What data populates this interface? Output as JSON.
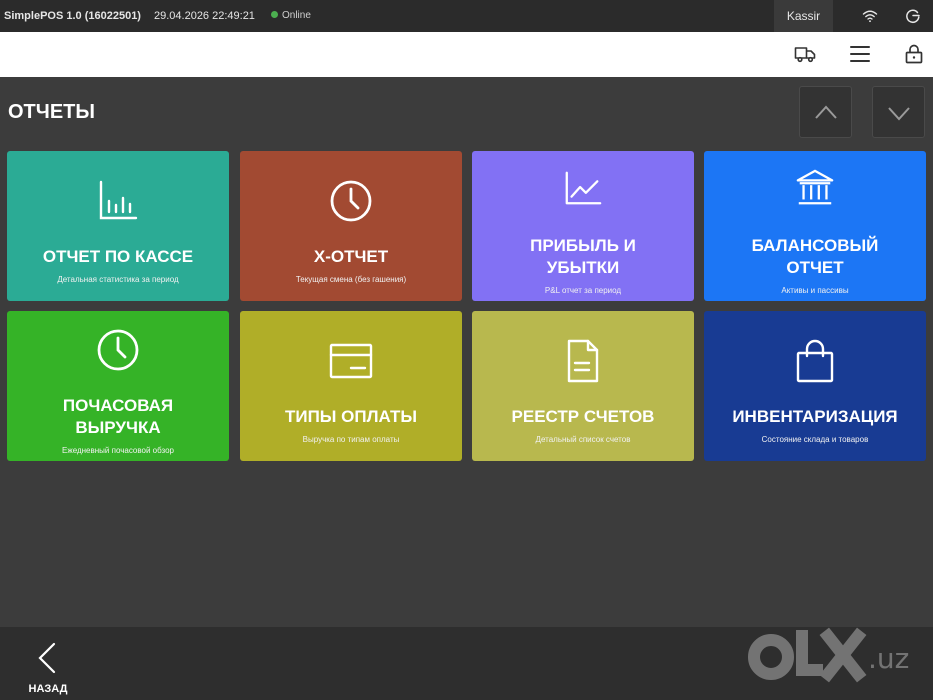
{
  "statusbar": {
    "app_name": "SimplePOS 1.0 (16022501)",
    "datetime": "29.04.2026 22:49:21",
    "connection": "Online",
    "user": "Kassir"
  },
  "toolbar": {
    "icons": [
      "delivery-truck-icon",
      "menu-icon",
      "lock-icon"
    ]
  },
  "page": {
    "title": "ОТЧЕТЫ"
  },
  "tiles": [
    {
      "title": "ОТЧЕТ ПО КАССЕ",
      "subtitle": "Детальная статистика за период",
      "color": "#2bab95",
      "icon": "bar-chart-icon"
    },
    {
      "title": "X-ОТЧЕТ",
      "subtitle": "Текущая смена (без гашения)",
      "color": "#a24a32",
      "icon": "clock-icon"
    },
    {
      "title_line1": "ПРИБЫЛЬ И",
      "title_line2": "УБЫТКИ",
      "subtitle": "P&L отчет за период",
      "color": "#8271f4",
      "icon": "line-chart-icon"
    },
    {
      "title_line1": "БАЛАНСОВЫЙ",
      "title_line2": "ОТЧЕТ",
      "subtitle": "Активы и пассивы",
      "color": "#1c76f5",
      "icon": "bank-icon"
    },
    {
      "title_line1": "ПОЧАСОВАЯ",
      "title_line2": "ВЫРУЧКА",
      "subtitle": "Ежедневный почасовой обзор",
      "color": "#35b327",
      "icon": "clock-icon"
    },
    {
      "title": "ТИПЫ ОПЛАТЫ",
      "subtitle": "Выручка по типам оплаты",
      "color": "#b0ae28",
      "icon": "credit-card-icon"
    },
    {
      "title": "РЕЕСТР СЧЕТОВ",
      "subtitle": "Детальный список счетов",
      "color": "#b8b84e",
      "icon": "document-icon"
    },
    {
      "title": "ИНВЕНТАРИЗАЦИЯ",
      "subtitle": "Состояние склада и товаров",
      "color": "#183b93",
      "icon": "shopping-bag-icon"
    }
  ],
  "bottombar": {
    "back_label": "НАЗАД"
  },
  "watermark": {
    "text": "olx.uz"
  }
}
